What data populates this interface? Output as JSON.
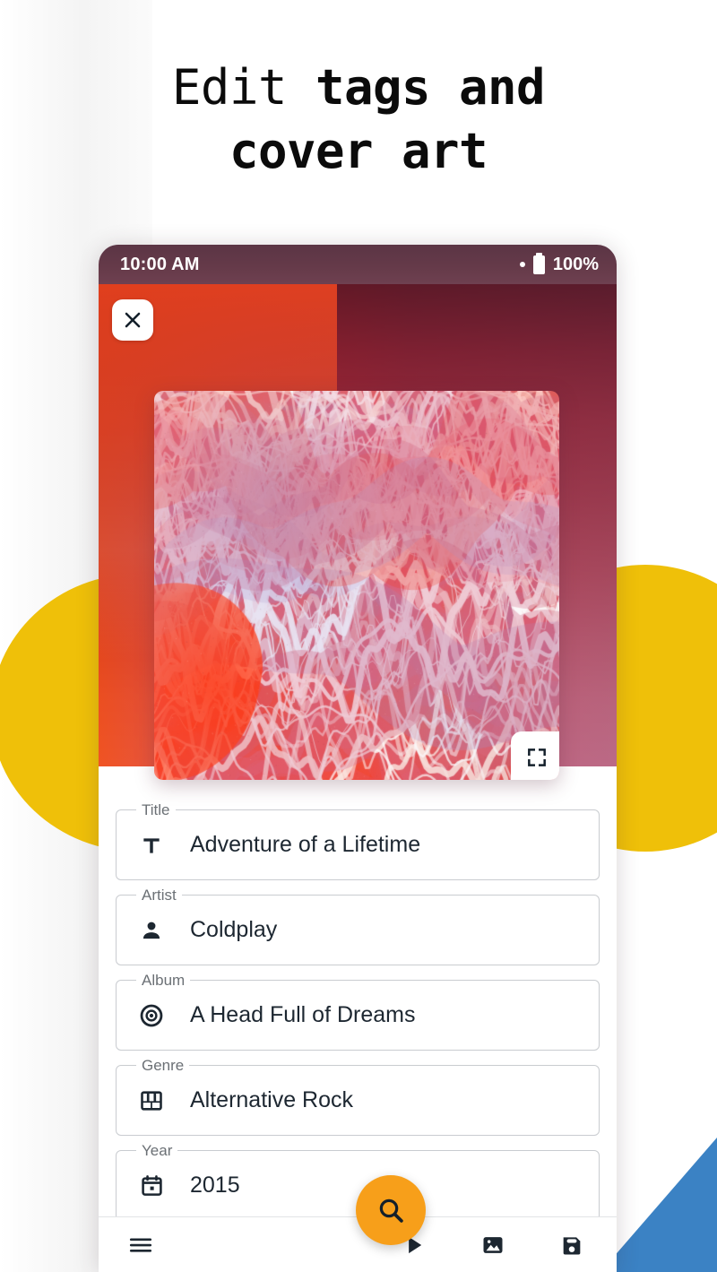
{
  "headline": {
    "line1_light": "Edit ",
    "line1_bold": "tags and",
    "line2_bold": "cover art"
  },
  "colors": {
    "accent_orange": "#F79F1A",
    "decor_yellow": "#EFC009",
    "decor_blue": "#3B82C4",
    "text_dark": "#1d2731",
    "field_border": "#c9ccd0",
    "label_grey": "#6b7075",
    "status_bar": "#653a49"
  },
  "status_bar": {
    "time": "10:00 AM",
    "battery_percent": "100%",
    "dot_icon": "dot-icon",
    "battery_icon": "battery-full-icon"
  },
  "app_bar": {
    "close_icon": "close-icon",
    "close_label": "Close"
  },
  "album_art": {
    "alt": "abstract marbled fluid art cover",
    "fullscreen_icon": "fullscreen-icon",
    "fullscreen_label": "Fullscreen"
  },
  "fields": [
    {
      "label": "Title",
      "value": "Adventure of a Lifetime",
      "icon": "text-format-icon"
    },
    {
      "label": "Artist",
      "value": "Coldplay",
      "icon": "person-icon"
    },
    {
      "label": "Album",
      "value": "A Head Full of Dreams",
      "icon": "album-disc-icon"
    },
    {
      "label": "Genre",
      "value": "Alternative Rock",
      "icon": "piano-keys-icon"
    },
    {
      "label": "Year",
      "value": "2015",
      "icon": "calendar-icon"
    }
  ],
  "fab": {
    "icon": "search-icon",
    "label": "Search"
  },
  "bottom_bar": {
    "menu_icon": "hamburger-menu-icon",
    "menu_label": "Menu",
    "actions": [
      {
        "icon": "play-icon",
        "label": "Play"
      },
      {
        "icon": "image-icon",
        "label": "Pick cover image"
      },
      {
        "icon": "save-icon",
        "label": "Save"
      }
    ]
  }
}
